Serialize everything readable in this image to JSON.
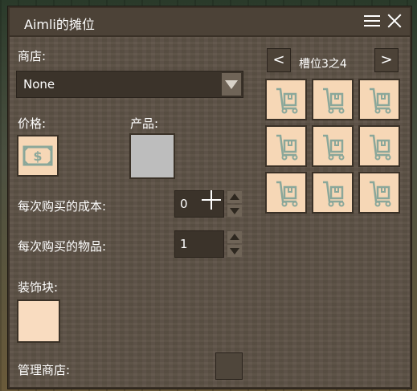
{
  "window": {
    "title": "Aimli的摊位"
  },
  "shop": {
    "label": "商店:",
    "selected": "None"
  },
  "price": {
    "label": "价格:"
  },
  "product": {
    "label": "产品:"
  },
  "cost_per_purchase": {
    "label": "每次购买的成本:",
    "value": "0"
  },
  "items_per_purchase": {
    "label": "每次购买的物品:",
    "value": "1"
  },
  "decoration": {
    "label": "装饰块:"
  },
  "manage": {
    "label": "管理商店:"
  },
  "slots": {
    "prev": "<",
    "next": ">",
    "label": "槽位3之4",
    "count": 9,
    "icon": "hand-truck-icon"
  },
  "colors": {
    "panel": "#5d5246",
    "slot": "#f6d7b6",
    "icon_line": "#8aa79a"
  }
}
